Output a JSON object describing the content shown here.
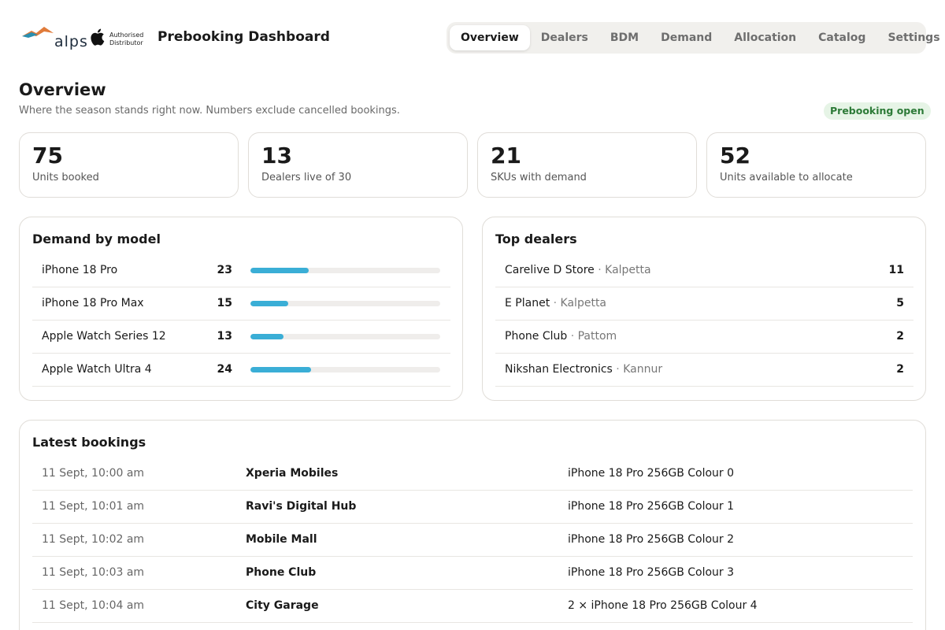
{
  "brand": {
    "logo_text": "alps",
    "apple_badge_line1": "Authorised",
    "apple_badge_line2": "Distributor"
  },
  "header": {
    "title": "Prebooking Dashboard"
  },
  "nav": {
    "tabs": [
      {
        "label": "Overview",
        "active": true
      },
      {
        "label": "Dealers",
        "active": false
      },
      {
        "label": "BDM",
        "active": false
      },
      {
        "label": "Demand",
        "active": false
      },
      {
        "label": "Allocation",
        "active": false
      },
      {
        "label": "Catalog",
        "active": false
      },
      {
        "label": "Settings",
        "active": false
      }
    ]
  },
  "overview": {
    "title": "Overview",
    "subtitle": "Where the season stands right now. Numbers exclude cancelled bookings.",
    "status": "Prebooking open"
  },
  "stats": [
    {
      "value": "75",
      "label": "Units booked"
    },
    {
      "value": "13",
      "label": "Dealers live of 30"
    },
    {
      "value": "21",
      "label": "SKUs with demand"
    },
    {
      "value": "52",
      "label": "Units available to allocate"
    }
  ],
  "demand_by_model": {
    "title": "Demand by model",
    "bar_scale_max": 75,
    "rows": [
      {
        "model": "iPhone 18 Pro",
        "count": "23",
        "value": 23
      },
      {
        "model": "iPhone 18 Pro Max",
        "count": "15",
        "value": 15
      },
      {
        "model": "Apple Watch Series 12",
        "count": "13",
        "value": 13
      },
      {
        "model": "Apple Watch Ultra 4",
        "count": "24",
        "value": 24
      }
    ]
  },
  "top_dealers": {
    "title": "Top dealers",
    "separator": "·",
    "rows": [
      {
        "name": "Carelive D Store",
        "city": "Kalpetta",
        "count": "11"
      },
      {
        "name": "E Planet",
        "city": "Kalpetta",
        "count": "5"
      },
      {
        "name": "Phone Club",
        "city": "Pattom",
        "count": "2"
      },
      {
        "name": "Nikshan Electronics",
        "city": "Kannur",
        "count": "2"
      }
    ]
  },
  "latest_bookings": {
    "title": "Latest bookings",
    "rows": [
      {
        "time": "11 Sept, 10:00 am",
        "dealer": "Xperia Mobiles",
        "item": "iPhone 18 Pro 256GB Colour 0"
      },
      {
        "time": "11 Sept, 10:01 am",
        "dealer": "Ravi's Digital Hub",
        "item": "iPhone 18 Pro 256GB Colour 1"
      },
      {
        "time": "11 Sept, 10:02 am",
        "dealer": "Mobile Mall",
        "item": "iPhone 18 Pro 256GB Colour 2"
      },
      {
        "time": "11 Sept, 10:03 am",
        "dealer": "Phone Club",
        "item": "iPhone 18 Pro 256GB Colour 3"
      },
      {
        "time": "11 Sept, 10:04 am",
        "dealer": "City Garage",
        "item": "2 × iPhone 18 Pro 256GB Colour 4"
      }
    ]
  },
  "colors": {
    "accent_bar": "#3aaed6",
    "status_green": "#2c7a37",
    "status_bg": "#e6f4e6"
  },
  "icons": {
    "brand_logo": "alps-mountain-logo",
    "apple_logo": "apple-icon"
  }
}
